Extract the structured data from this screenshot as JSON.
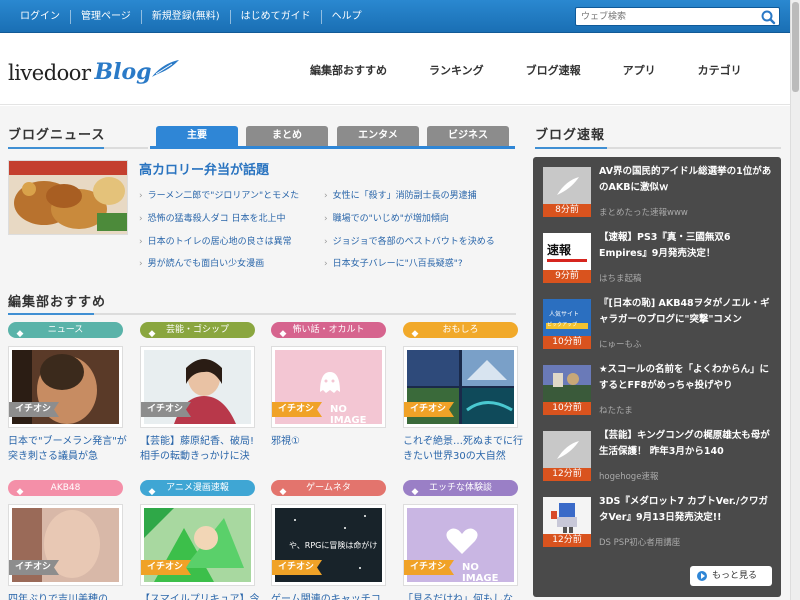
{
  "topbar": {
    "links": [
      "ログイン",
      "管理ページ",
      "新規登録(無料)",
      "はじめてガイド",
      "ヘルプ"
    ],
    "search_placeholder": "ウェブ検索"
  },
  "header": {
    "logo_main": "livedoor",
    "logo_blog": "Blog",
    "nav": [
      "編集部おすすめ",
      "ランキング",
      "ブログ速報",
      "アプリ",
      "カテゴリ"
    ]
  },
  "news": {
    "section_title": "ブログニュース",
    "tabs": [
      {
        "label": "主要",
        "active": true
      },
      {
        "label": "まとめ",
        "active": false
      },
      {
        "label": "エンタメ",
        "active": false
      },
      {
        "label": "ビジネス",
        "active": false
      }
    ],
    "headline": "高カロリー弁当が話題",
    "items_left": [
      "ラーメン二郎で\"ジロリアン\"とモメた",
      "恐怖の猛毒殺人ダコ 日本を北上中",
      "日本のトイレの居心地の良さは異常",
      "男が読んでも面白い少女漫画"
    ],
    "items_right": [
      "女性に「殺す」消防副士長の男逮捕",
      "職場での\"いじめ\"が増加傾向",
      "ジョジョで各部のベストバウトを決める",
      "日本女子バレーに\"八百長疑惑\"?"
    ]
  },
  "editor": {
    "section_title": "編集部おすすめ",
    "ribbon": "イチオシ",
    "no_image": "NO IMAGE",
    "row1": [
      {
        "category": "ニュース",
        "color": "#5ab3a9",
        "title": "日本で\"ブーメラン発言\"が突き刺さる議員が急"
      },
      {
        "category": "芸能・ゴシップ",
        "color": "#8aa63f",
        "title": "【芸能】藤原紀香、破局!相手の転動きっかけに決"
      },
      {
        "category": "怖い話・オカルト",
        "color": "#d6648e",
        "title": "邪視①"
      },
      {
        "category": "おもしろ",
        "color": "#f1a92a",
        "title": "これぞ絶景…死ぬまでに行きたい世界30の大自然"
      }
    ],
    "row2": [
      {
        "category": "AKB48",
        "color": "#f48fa8",
        "title": "四年ぶりで吉川美穂の"
      },
      {
        "category": "アニメ漫画速報",
        "color": "#3fa6d4",
        "title": "【スマイルプリキュア】今"
      },
      {
        "category": "ゲームネタ",
        "color": "#e3746d",
        "title": "ゲーム関連のキャッチコ"
      },
      {
        "category": "エッチな体験談",
        "color": "#9a7fc6",
        "title": "「見るだけね」何もしな"
      }
    ]
  },
  "sidebar": {
    "section_title": "ブログ速報",
    "items": [
      {
        "title": "AV界の国民的アイドル総選挙の1位があのAKBに激似ｗ",
        "time": "8分前",
        "source": "まとめたった速報www"
      },
      {
        "title": "【速報】PS3『真・三國無双6 Empires』9月発売決定！",
        "time": "9分前",
        "source": "はちま起稿"
      },
      {
        "title": "『[日本の恥] AKB48ヲタがノエル・ギャラガーのブログに\"突撃\"コメン",
        "time": "10分前",
        "source": "にゅーもふ"
      },
      {
        "title": "★スコールの名前を「よくわからん」にするとFF8がめっちゃ投げやり",
        "time": "10分前",
        "source": "ねたたま"
      },
      {
        "title": "【芸能】キングコングの梶原雄太も母が生活保護！ 昨年3月から140",
        "time": "12分前",
        "source": "hogehoge速報"
      },
      {
        "title": "3DS『メダロット7 カブトVer./クワガタVer』9月13日発売決定!!",
        "time": "12分前",
        "source": "DS PSP初心者用講座"
      }
    ],
    "more": "もっと見る"
  }
}
